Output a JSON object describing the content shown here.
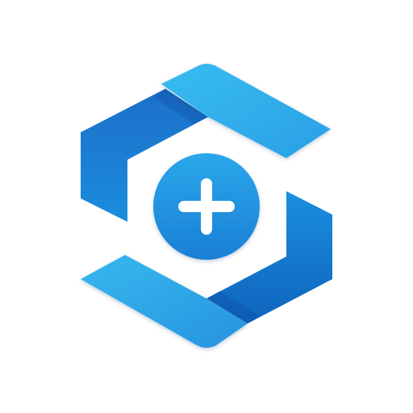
{
  "app_icon": {
    "name": "hexagon-plus-logo",
    "icon": "hexagon-plus-icon",
    "colors": {
      "background": "#ffffff",
      "light_blue": "#31b3ec",
      "mid_blue": "#1c86d8",
      "dark_blue": "#0b5fb8",
      "plus": "#ffffff"
    }
  }
}
